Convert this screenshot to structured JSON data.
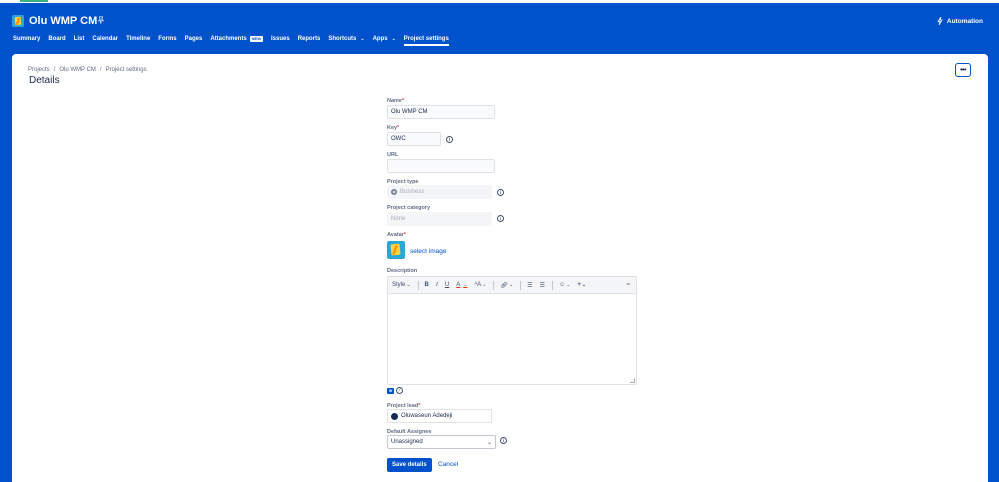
{
  "header": {
    "project_title": "Olu WMP CM",
    "automation_label": "Automation",
    "tabs": [
      {
        "label": "Summary"
      },
      {
        "label": "Board"
      },
      {
        "label": "List"
      },
      {
        "label": "Calendar"
      },
      {
        "label": "Timeline"
      },
      {
        "label": "Forms"
      },
      {
        "label": "Pages"
      },
      {
        "label": "Attachments",
        "badge": "NEW"
      },
      {
        "label": "Issues"
      },
      {
        "label": "Reports"
      },
      {
        "label": "Shortcuts"
      },
      {
        "label": "Apps"
      },
      {
        "label": "Project settings",
        "active": true
      }
    ]
  },
  "breadcrumb": {
    "items": [
      "Projects",
      "Olu WMP CM",
      "Project settings"
    ],
    "separator": "/"
  },
  "page_title": "Details",
  "more_button_label": "•••",
  "form": {
    "name": {
      "label": "Name",
      "required": "*",
      "value": "Olu WMP CM"
    },
    "key": {
      "label": "Key",
      "required": "*",
      "value": "OWC"
    },
    "url": {
      "label": "URL",
      "value": ""
    },
    "project_type": {
      "label": "Project type",
      "value": "Business"
    },
    "project_category": {
      "label": "Project category",
      "placeholder": "None"
    },
    "avatar": {
      "label": "Avatar",
      "required": "*",
      "select_link": "select image"
    },
    "description": {
      "label": "Description",
      "toolbar": {
        "style": "Style",
        "bold": "B",
        "italic": "I",
        "underline": "U",
        "text_color": "A",
        "font_size": "ᴬA",
        "link_icon": "🔗︎",
        "bullets": "☰",
        "numbers": "☰",
        "emoji": "☺",
        "insert": "+",
        "collapse": "≈"
      },
      "value": ""
    },
    "project_lead": {
      "label": "Project lead",
      "required": "*",
      "value": "Oluwaseun Adedeji"
    },
    "default_assignee": {
      "label": "Default Assignee",
      "value": "Unassigned"
    },
    "info_glyph": "i",
    "help_glyph": "?",
    "wiki_glyph": "W"
  },
  "actions": {
    "save_label": "Save details",
    "cancel_label": "Cancel"
  },
  "colors": {
    "brand": "#0052CC",
    "required": "#DE350B",
    "link": "#0052CC"
  }
}
